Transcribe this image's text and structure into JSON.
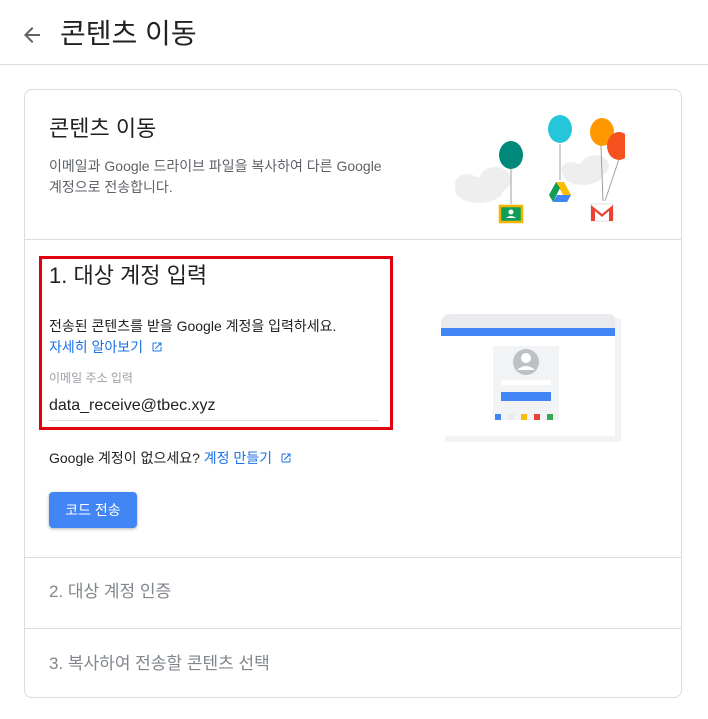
{
  "header": {
    "title": "콘텐츠 이동"
  },
  "card": {
    "title": "콘텐츠 이동",
    "description": "이메일과 Google 드라이브 파일을 복사하여 다른 Google 계정으로 전송합니다."
  },
  "step1": {
    "title": "1. 대상 계정 입력",
    "description": "전송된 콘텐츠를 받을 Google 계정을 입력하세요.",
    "learn_more": "자세히 알아보기",
    "email_label": "이메일 주소 입력",
    "email_value": "data_receive@tbec.xyz",
    "no_account_text": "Google 계정이 없으세요?",
    "create_account_link": "계정 만들기",
    "send_code_button": "코드 전송"
  },
  "step2": {
    "title": "2. 대상 계정 인증"
  },
  "step3": {
    "title": "3. 복사하여 전송할 콘텐츠 선택"
  },
  "colors": {
    "accent": "#4285f4",
    "link": "#1a73e8",
    "highlight_border": "#e1000f"
  }
}
